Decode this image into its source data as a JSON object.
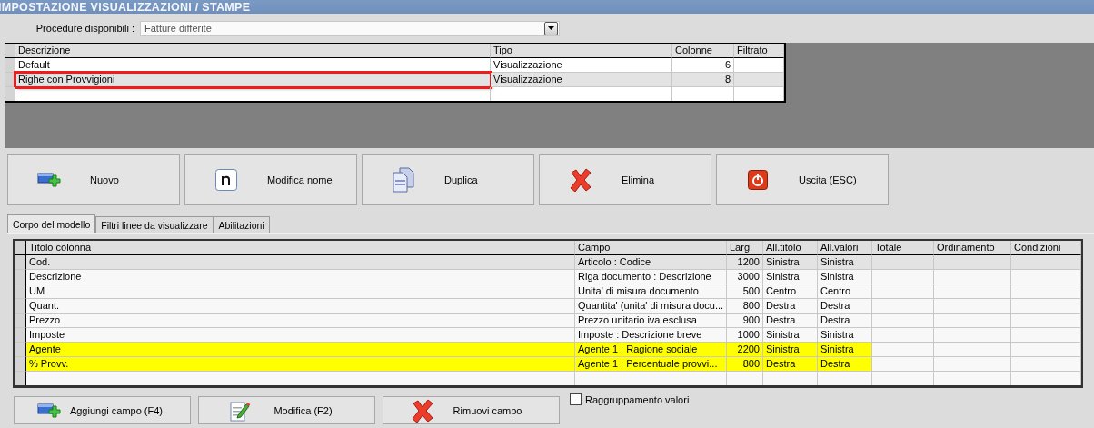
{
  "window": {
    "title": "IMPOSTAZIONE VISUALIZZAZIONI / STAMPE"
  },
  "procedure": {
    "label": "Procedure disponibili :",
    "value": "Fatture differite"
  },
  "models": {
    "columns": [
      "Descrizione",
      "Tipo",
      "Colonne",
      "Filtrato"
    ],
    "rows": [
      {
        "cells": [
          "Default",
          "Visualizzazione",
          "6",
          ""
        ],
        "selected": false,
        "marked": false
      },
      {
        "cells": [
          "Righe con Provvigioni",
          "Visualizzazione",
          "8",
          ""
        ],
        "selected": true,
        "marked": true
      }
    ]
  },
  "buttons": [
    {
      "label": "Nuovo",
      "kind": "new"
    },
    {
      "label": "Modifica nome",
      "kind": "rename"
    },
    {
      "label": "Duplica",
      "kind": "duplicate"
    },
    {
      "label": "Elimina",
      "kind": "delete"
    },
    {
      "label": "Uscita (ESC)",
      "kind": "exit"
    }
  ],
  "tabs": [
    {
      "label": "Corpo del modello",
      "selected": true
    },
    {
      "label": "Filtri linee da visualizzare",
      "selected": false
    },
    {
      "label": "Abilitazioni",
      "selected": false
    }
  ],
  "fields": {
    "columns": [
      "Titolo colonna",
      "Campo",
      "Larg.",
      "All.titolo",
      "All.valori",
      "Totale",
      "Ordinamento",
      "Condizioni"
    ],
    "rows": [
      {
        "cells": [
          "Cod.",
          "Articolo : Codice",
          "1200",
          "Sinistra",
          "Sinistra"
        ],
        "selected": true,
        "highlighted": false
      },
      {
        "cells": [
          "Descrizione",
          "Riga documento : Descrizione",
          "3000",
          "Sinistra",
          "Sinistra"
        ],
        "selected": false,
        "highlighted": false
      },
      {
        "cells": [
          "UM",
          "Unita' di misura documento",
          "500",
          "Centro",
          "Centro"
        ],
        "selected": false,
        "highlighted": false
      },
      {
        "cells": [
          "Quant.",
          "Quantita' (unita' di misura docu...",
          "800",
          "Destra",
          "Destra"
        ],
        "selected": false,
        "highlighted": false
      },
      {
        "cells": [
          "Prezzo",
          "Prezzo unitario iva esclusa",
          "900",
          "Destra",
          "Destra"
        ],
        "selected": false,
        "highlighted": false
      },
      {
        "cells": [
          "Imposte",
          "Imposte : Descrizione breve",
          "1000",
          "Sinistra",
          "Sinistra"
        ],
        "selected": false,
        "highlighted": false
      },
      {
        "cells": [
          "Agente",
          "Agente 1 : Ragione sociale",
          "2200",
          "Sinistra",
          "Sinistra"
        ],
        "selected": false,
        "highlighted": true
      },
      {
        "cells": [
          "% Provv.",
          "Agente 1 : Percentuale provvi...",
          "800",
          "Destra",
          "Destra"
        ],
        "selected": false,
        "highlighted": true
      }
    ]
  },
  "field_buttons": [
    {
      "label": "Aggiungi campo (F4)",
      "kind": "add"
    },
    {
      "label": "Modifica (F2)",
      "kind": "edit"
    },
    {
      "label": "Rimuovi campo",
      "kind": "delete"
    }
  ],
  "grouping": {
    "label": "Raggruppamento valori",
    "checked": false
  }
}
